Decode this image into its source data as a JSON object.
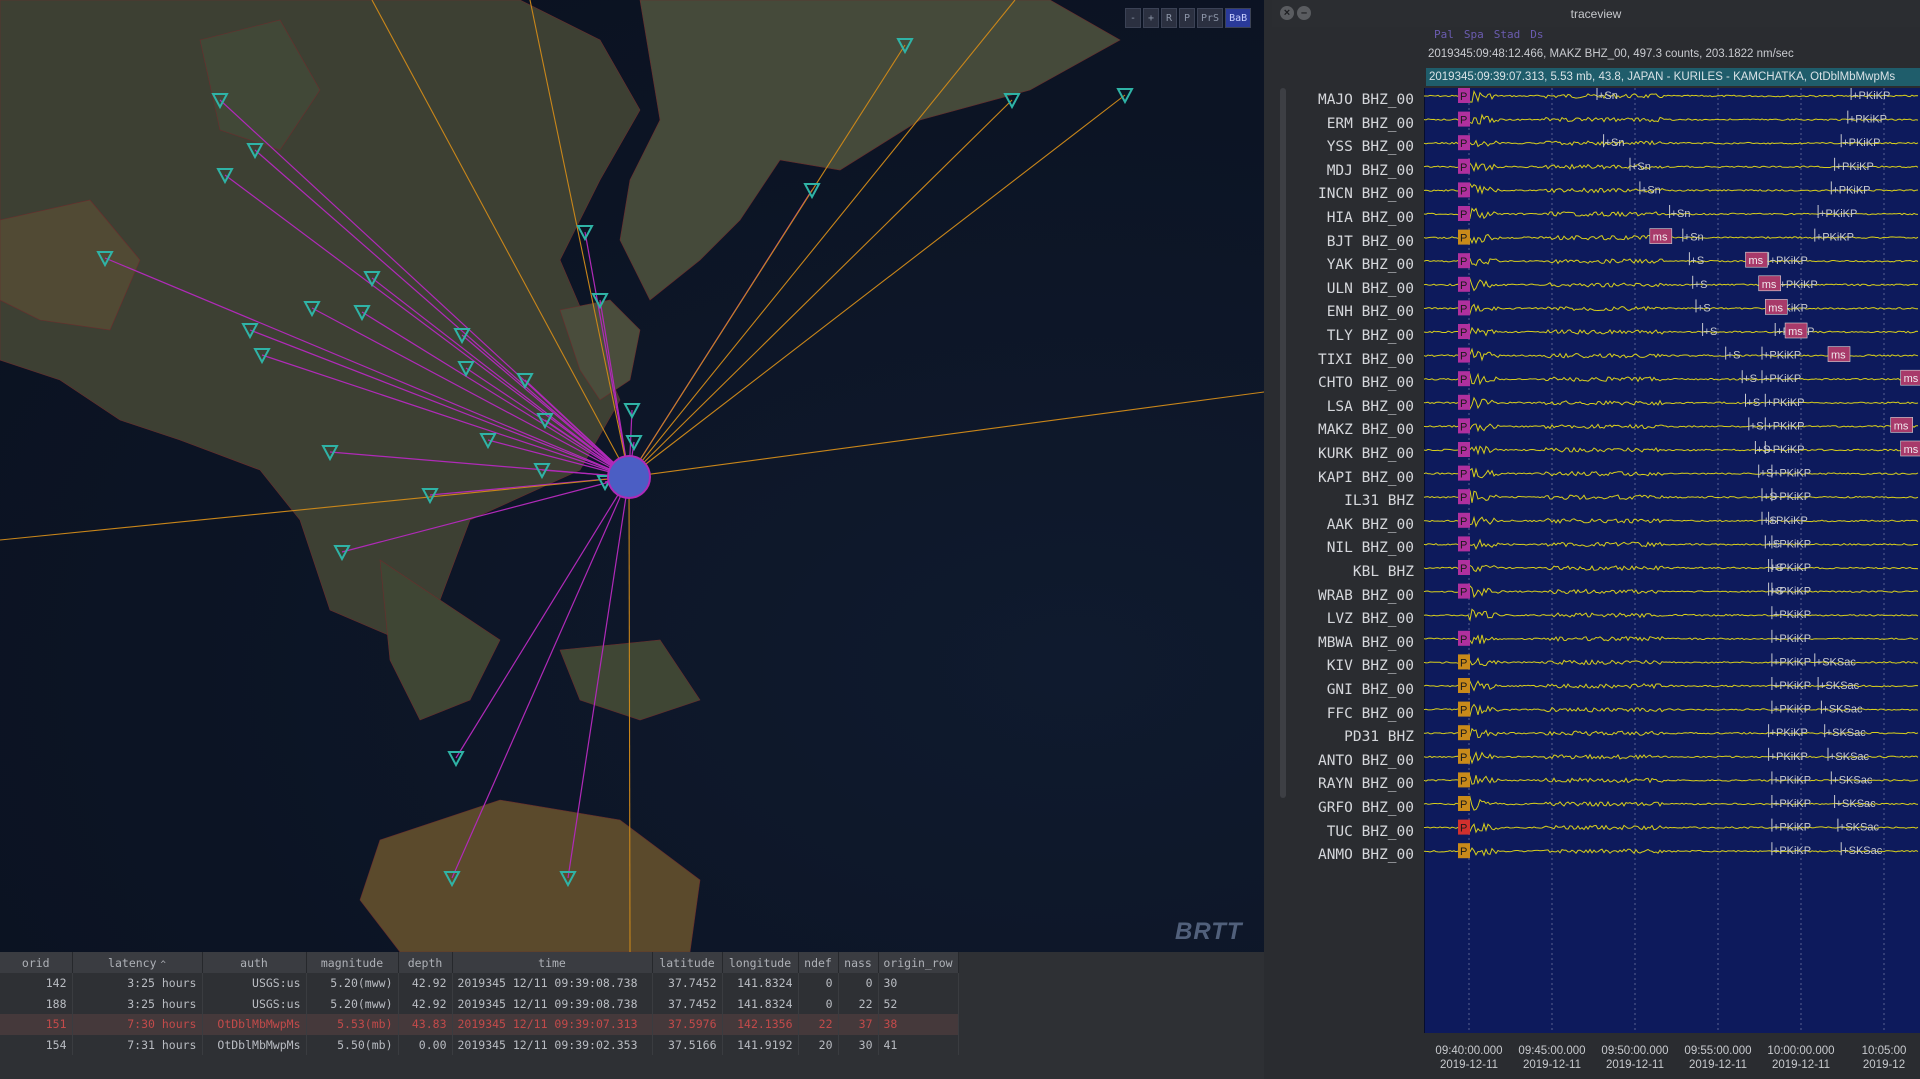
{
  "map": {
    "toolbar": [
      {
        "label": "-",
        "active": false
      },
      {
        "label": "+",
        "active": false
      },
      {
        "label": "R",
        "active": false
      },
      {
        "label": "P",
        "active": false
      },
      {
        "label": "PrS",
        "active": false
      },
      {
        "label": "BaB",
        "active": true
      }
    ],
    "watermark": "BRTT",
    "colors": {
      "ocean": "#0c1424",
      "land": "#4a4b3a",
      "pink_ray": "#b02ab8",
      "orange_ray": "#c9861a",
      "station": "#2fb3a6",
      "event": "#4b5ec4"
    }
  },
  "event_table": {
    "columns": [
      "orid",
      "latency",
      "auth",
      "magnitude",
      "depth",
      "time",
      "latitude",
      "longitude",
      "ndef",
      "nass",
      "origin_row"
    ],
    "sort_column": "latency",
    "rows": [
      {
        "orid": "142",
        "latency": "3:25 hours",
        "auth": "USGS:us",
        "magnitude": "5.20(mww)",
        "depth": "42.92",
        "time": "2019345 12/11 09:39:08.738",
        "latitude": "37.7452",
        "longitude": "141.8324",
        "ndef": "0",
        "nass": "0",
        "origin_row": "30",
        "selected": false
      },
      {
        "orid": "188",
        "latency": "3:25 hours",
        "auth": "USGS:us",
        "magnitude": "5.20(mww)",
        "depth": "42.92",
        "time": "2019345 12/11 09:39:08.738",
        "latitude": "37.7452",
        "longitude": "141.8324",
        "ndef": "0",
        "nass": "22",
        "origin_row": "52",
        "selected": false
      },
      {
        "orid": "151",
        "latency": "7:30 hours",
        "auth": "OtDblMbMwpMs",
        "magnitude": "5.53(mb)",
        "depth": "43.83",
        "time": "2019345 12/11 09:39:07.313",
        "latitude": "37.5976",
        "longitude": "142.1356",
        "ndef": "22",
        "nass": "37",
        "origin_row": "38",
        "selected": true
      },
      {
        "orid": "154",
        "latency": "7:31 hours",
        "auth": "OtDblMbMwpMs",
        "magnitude": "5.50(mb)",
        "depth": "0.00",
        "time": "2019345 12/11 09:39:02.353",
        "latitude": "37.5166",
        "longitude": "141.9192",
        "ndef": "20",
        "nass": "30",
        "origin_row": "41",
        "selected": false
      }
    ]
  },
  "traceview": {
    "title": "traceview",
    "menu": [
      "Pal",
      "Spa",
      "Stad",
      "Ds"
    ],
    "status_cursor": "2019345:09:48:12.466, MAKZ BHZ_00, 497.3 counts, 203.1822 nm/sec",
    "status_event": "2019345:09:39:07.313, 5.53 mb, 43.8, JAPAN - KURILES - KAMCHATKA, OtDblMbMwpMs",
    "stations": [
      {
        "name": "MAJO BHZ_00",
        "p": "P",
        "pcolor": "#b0309e",
        "phases": [
          {
            "t": 5,
            "l": "+Sn"
          },
          {
            "t": 12.7,
            "l": "+PKiKP"
          }
        ]
      },
      {
        "name": "ERM BHZ_00",
        "p": "P",
        "pcolor": "#b0309e",
        "phases": [
          {
            "t": 12.6,
            "l": "+PKiKP"
          }
        ]
      },
      {
        "name": "YSS BHZ_00",
        "p": "P",
        "pcolor": "#b0309e",
        "phases": [
          {
            "t": 5.2,
            "l": "+Sn"
          },
          {
            "t": 12.4,
            "l": "+PKiKP"
          }
        ]
      },
      {
        "name": "MDJ BHZ_00",
        "p": "P",
        "pcolor": "#b0309e",
        "phases": [
          {
            "t": 6,
            "l": "+Sn"
          },
          {
            "t": 12.2,
            "l": "+PKiKP"
          }
        ]
      },
      {
        "name": "INCN BHZ_00",
        "p": "P",
        "pcolor": "#b0309e",
        "phases": [
          {
            "t": 6.3,
            "l": "+Sn"
          },
          {
            "t": 12.1,
            "l": "+PKiKP"
          }
        ]
      },
      {
        "name": "HIA BHZ_00",
        "p": "P",
        "pcolor": "#b0309e",
        "phases": [
          {
            "t": 7.2,
            "l": "+Sn"
          },
          {
            "t": 11.7,
            "l": "+PKiKP"
          }
        ]
      },
      {
        "name": "BJT BHZ_00",
        "p": "P",
        "pcolor": "#c98a1a",
        "ms": 6.6,
        "phases": [
          {
            "t": 7.6,
            "l": "+Sn"
          },
          {
            "t": 11.6,
            "l": "+PKiKP"
          }
        ]
      },
      {
        "name": "YAK BHZ_00",
        "p": "P",
        "pcolor": "#b0309e",
        "ms": 9.5,
        "phases": [
          {
            "t": 7.8,
            "l": "+S"
          },
          {
            "t": 10.2,
            "l": "+PKiKP"
          }
        ]
      },
      {
        "name": "ULN BHZ_00",
        "p": "P",
        "pcolor": "#b0309e",
        "ms": 9.9,
        "phases": [
          {
            "t": 7.9,
            "l": "+S"
          },
          {
            "t": 10.5,
            "l": "+PKiKP"
          }
        ]
      },
      {
        "name": "ENH BHZ_00",
        "p": "P",
        "pcolor": "#b0309e",
        "ms": 10.1,
        "phases": [
          {
            "t": 8,
            "l": "+S"
          },
          {
            "t": 10.4,
            "l": "PKiKP"
          }
        ]
      },
      {
        "name": "TLY BHZ_00",
        "p": "P",
        "pcolor": "#b0309e",
        "ms": 10.7,
        "phases": [
          {
            "t": 8.2,
            "l": "+S"
          },
          {
            "t": 10.4,
            "l": "+PKiKP"
          }
        ]
      },
      {
        "name": "TIXI BHZ_00",
        "p": "P",
        "pcolor": "#b0309e",
        "ms": 12,
        "phases": [
          {
            "t": 8.9,
            "l": "+S"
          },
          {
            "t": 10,
            "l": "+PKiKP"
          }
        ]
      },
      {
        "name": "CHTO BHZ_00",
        "p": "P",
        "pcolor": "#b0309e",
        "ms": 14.2,
        "phases": [
          {
            "t": 9.4,
            "l": "+S"
          },
          {
            "t": 10,
            "l": "+PKiKP"
          }
        ]
      },
      {
        "name": "LSA BHZ_00",
        "p": "P",
        "pcolor": "#b0309e",
        "phases": [
          {
            "t": 9.5,
            "l": "+S"
          },
          {
            "t": 10.1,
            "l": "+PKiKP"
          }
        ]
      },
      {
        "name": "MAKZ BHZ_00",
        "p": "P",
        "pcolor": "#b0309e",
        "ms": 13.9,
        "phases": [
          {
            "t": 9.6,
            "l": "+S"
          },
          {
            "t": 10.1,
            "l": "+PKiKP"
          }
        ]
      },
      {
        "name": "KURK BHZ_00",
        "p": "P",
        "pcolor": "#b0309e",
        "ms": 14.2,
        "phases": [
          {
            "t": 9.8,
            "l": "+S"
          },
          {
            "t": 10.1,
            "l": "+PKiKP"
          }
        ]
      },
      {
        "name": "KAPI BHZ_00",
        "p": "P",
        "pcolor": "#b0309e",
        "phases": [
          {
            "t": 9.9,
            "l": "+S"
          },
          {
            "t": 10.3,
            "l": "+PKiKP"
          }
        ]
      },
      {
        "name": "IL31 BHZ",
        "p": "P",
        "pcolor": "#b0309e",
        "phases": [
          {
            "t": 10,
            "l": "+S"
          },
          {
            "t": 10.3,
            "l": "+PKiKP"
          }
        ]
      },
      {
        "name": "AAK BHZ_00",
        "p": "P",
        "pcolor": "#b0309e",
        "ms": 16.9,
        "phases": [
          {
            "t": 10,
            "l": "+S"
          },
          {
            "t": 10.2,
            "l": "+PKiKP"
          }
        ]
      },
      {
        "name": "NIL BHZ_00",
        "p": "P",
        "pcolor": "#b0309e",
        "phases": [
          {
            "t": 10.1,
            "l": "+S"
          },
          {
            "t": 10.3,
            "l": "+PKiKP"
          }
        ]
      },
      {
        "name": "KBL BHZ",
        "p": "P",
        "pcolor": "#b0309e",
        "phases": [
          {
            "t": 10.2,
            "l": "+S"
          },
          {
            "t": 10.3,
            "l": "+PKiKP"
          }
        ]
      },
      {
        "name": "WRAB BHZ_00",
        "p": "P",
        "pcolor": "#b0309e",
        "phases": [
          {
            "t": 10.2,
            "l": "+S"
          },
          {
            "t": 10.3,
            "l": "+PKiKP"
          }
        ]
      },
      {
        "name": "LVZ BHZ_00",
        "p": "",
        "pcolor": "#b0309e",
        "phases": [
          {
            "t": 10.3,
            "l": "+PKiKP"
          }
        ]
      },
      {
        "name": "MBWA BHZ_00",
        "p": "P",
        "pcolor": "#b0309e",
        "phases": [
          {
            "t": 10.3,
            "l": "+PKiKP"
          }
        ]
      },
      {
        "name": "KIV BHZ_00",
        "p": "P",
        "pcolor": "#c98a1a",
        "phases": [
          {
            "t": 10.3,
            "l": "+PKiKP"
          },
          {
            "t": 11.6,
            "l": "+SKSac"
          }
        ]
      },
      {
        "name": "GNI BHZ_00",
        "p": "P",
        "pcolor": "#c98a1a",
        "phases": [
          {
            "t": 10.3,
            "l": "+PKiKP"
          },
          {
            "t": 11.7,
            "l": "+SKSac"
          }
        ]
      },
      {
        "name": "FFC BHZ_00",
        "p": "P",
        "pcolor": "#c98a1a",
        "phases": [
          {
            "t": 10.3,
            "l": "+PKiKP"
          },
          {
            "t": 11.8,
            "l": "+SKSac"
          }
        ]
      },
      {
        "name": "PD31 BHZ",
        "p": "P",
        "pcolor": "#c98a1a",
        "phases": [
          {
            "t": 10.2,
            "l": "+PKiKP"
          },
          {
            "t": 11.9,
            "l": "+SKSac"
          }
        ]
      },
      {
        "name": "ANTO BHZ_00",
        "p": "P",
        "pcolor": "#c98a1a",
        "phases": [
          {
            "t": 10.2,
            "l": "+PKiKP"
          },
          {
            "t": 12,
            "l": "+SKSac"
          }
        ]
      },
      {
        "name": "RAYN BHZ_00",
        "p": "P",
        "pcolor": "#c98a1a",
        "phases": [
          {
            "t": 10.3,
            "l": "+PKiKP"
          },
          {
            "t": 12.1,
            "l": "+SKSac"
          }
        ]
      },
      {
        "name": "GRFO BHZ_00",
        "p": "P",
        "pcolor": "#c98a1a",
        "phases": [
          {
            "t": 10.3,
            "l": "+PKiKP"
          },
          {
            "t": 12.2,
            "l": "+SKSac"
          }
        ]
      },
      {
        "name": "TUC BHZ_00",
        "p": "P",
        "pcolor": "#d0302e",
        "phases": [
          {
            "t": 10.3,
            "l": "+PKiKP"
          },
          {
            "t": 12.3,
            "l": "+SKSac"
          }
        ]
      },
      {
        "name": "ANMO BHZ_00",
        "p": "P",
        "pcolor": "#c98a1a",
        "phases": [
          {
            "t": 10.3,
            "l": "+PKiKP"
          },
          {
            "t": 12.4,
            "l": "+SKSac"
          }
        ]
      }
    ],
    "time_ticks": [
      {
        "t": "09:40:00.000",
        "d": "2019-12-11"
      },
      {
        "t": "09:45:00.000",
        "d": "2019-12-11"
      },
      {
        "t": "09:50:00.000",
        "d": "2019-12-11"
      },
      {
        "t": "09:55:00.000",
        "d": "2019-12-11"
      },
      {
        "t": "10:00:00.000",
        "d": "2019-12-11"
      },
      {
        "t": "10:05:00",
        "d": "2019-12"
      }
    ],
    "colors": {
      "trace_bg": "#0d1a5c",
      "trace": "#d8cf1c",
      "ms_badge": "#a83a6a"
    }
  }
}
